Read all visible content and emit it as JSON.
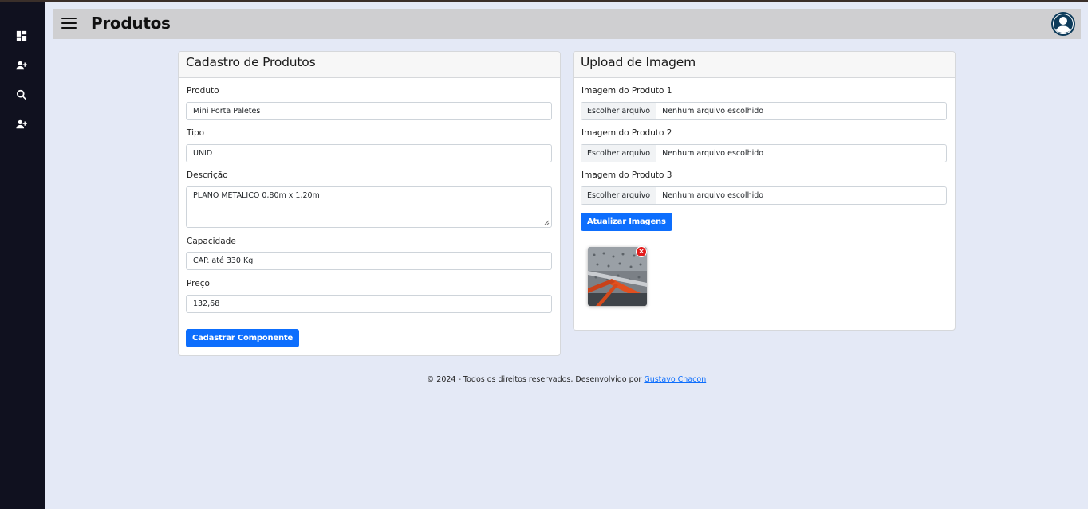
{
  "header": {
    "title": "Produtos",
    "menu_icon": "hamburger-menu-icon",
    "avatar_icon": "user-avatar-icon"
  },
  "sidebar": {
    "items": [
      {
        "icon": "dashboard-icon"
      },
      {
        "icon": "add-user-icon"
      },
      {
        "icon": "search-icon"
      },
      {
        "icon": "add-user-icon"
      }
    ]
  },
  "product_form": {
    "title": "Cadastro de Produtos",
    "produto_label": "Produto",
    "produto_value": "Mini Porta Paletes",
    "tipo_label": "Tipo",
    "tipo_value": "UNID",
    "descricao_label": "Descrição",
    "descricao_value": "PLANO METALICO 0,80m x 1,20m",
    "capacidade_label": "Capacidade",
    "capacidade_value": "CAP. até 330 Kg",
    "preco_label": "Preço",
    "preco_value": "132,68",
    "submit_label": "Cadastrar Componente"
  },
  "upload": {
    "title": "Upload de Imagem",
    "files": [
      {
        "label": "Imagem do Produto 1",
        "button": "Escolher arquivo",
        "status": "Nenhum arquivo escolhido"
      },
      {
        "label": "Imagem do Produto 2",
        "button": "Escolher arquivo",
        "status": "Nenhum arquivo escolhido"
      },
      {
        "label": "Imagem do Produto 3",
        "button": "Escolher arquivo",
        "status": "Nenhum arquivo escolhido"
      }
    ],
    "update_label": "Atualizar Imagens",
    "remove_symbol": "×"
  },
  "footer": {
    "text": "© 2024 - Todos os direitos reservados, Desenvolvido por ",
    "link": "Gustavo Chacon"
  },
  "colors": {
    "primary": "#0d6efd",
    "sidebar": "#10111f",
    "background": "#e4e9f6",
    "header": "#cfcfd1",
    "remove": "#e31b1b"
  }
}
